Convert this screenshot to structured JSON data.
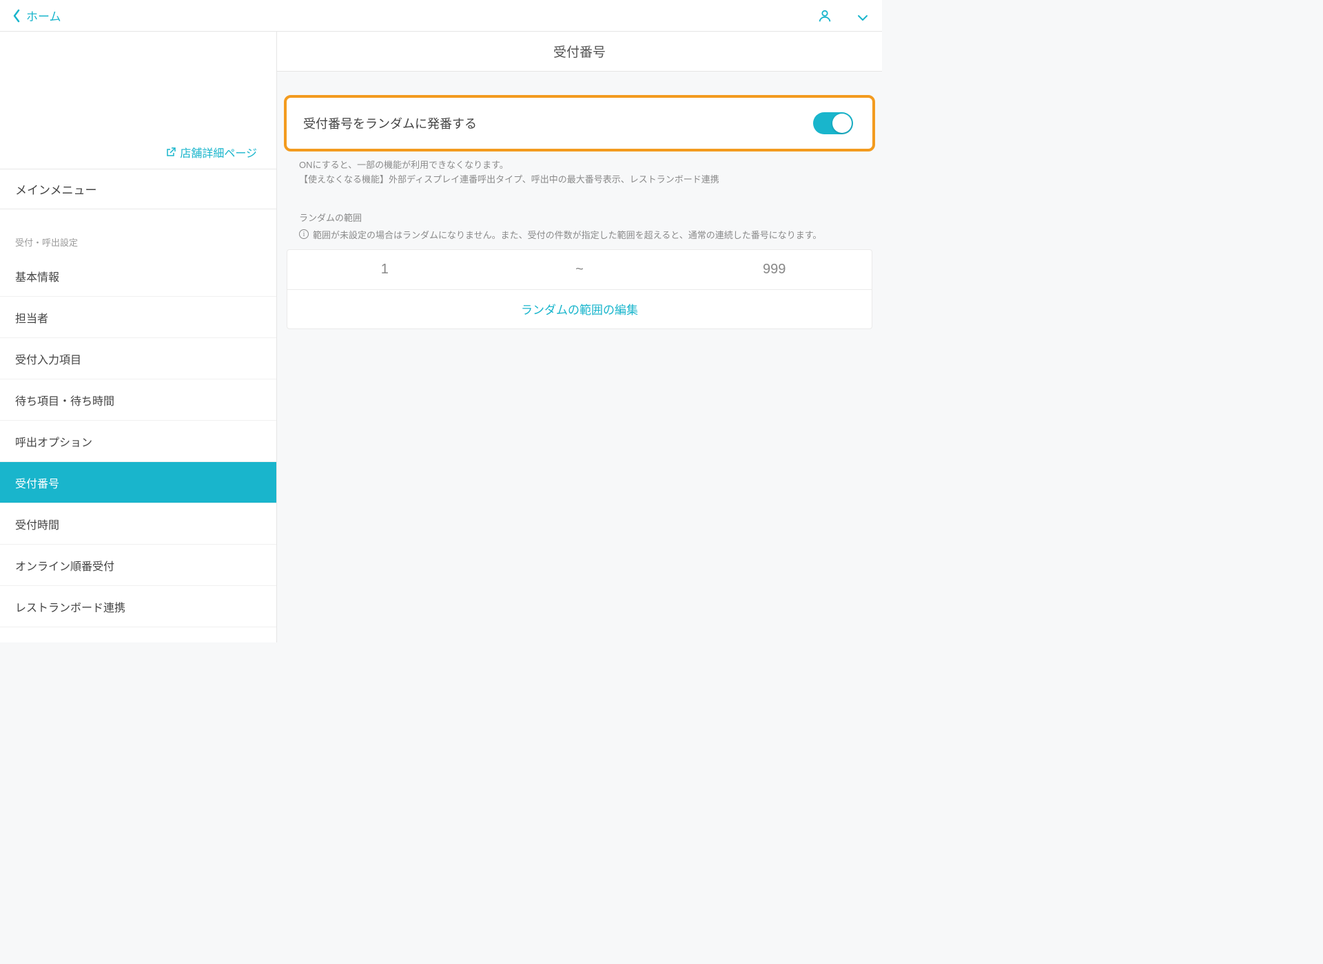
{
  "header": {
    "back_label": "ホーム"
  },
  "sidebar": {
    "store_link": "店舗詳細ページ",
    "main_menu_label": "メインメニュー",
    "section_label": "受付・呼出設定",
    "items": [
      {
        "label": "基本情報",
        "active": false
      },
      {
        "label": "担当者",
        "active": false
      },
      {
        "label": "受付入力項目",
        "active": false
      },
      {
        "label": "待ち項目・待ち時間",
        "active": false
      },
      {
        "label": "呼出オプション",
        "active": false
      },
      {
        "label": "受付番号",
        "active": true
      },
      {
        "label": "受付時間",
        "active": false
      },
      {
        "label": "オンライン順番受付",
        "active": false
      },
      {
        "label": "レストランボード連携",
        "active": false
      }
    ]
  },
  "content": {
    "title": "受付番号",
    "toggle_label": "受付番号をランダムに発番する",
    "help_line1": "ONにすると、一部の機能が利用できなくなります。",
    "help_line2": "【使えなくなる機能】外部ディスプレイ連番呼出タイプ、呼出中の最大番号表示、レストランボード連携",
    "range_section_label": "ランダムの範囲",
    "range_info": "範囲が未設定の場合はランダムになりません。また、受付の件数が指定した範囲を超えると、通常の連続した番号になります。",
    "range_min": "1",
    "range_sep": "~",
    "range_max": "999",
    "edit_label": "ランダムの範囲の編集"
  }
}
